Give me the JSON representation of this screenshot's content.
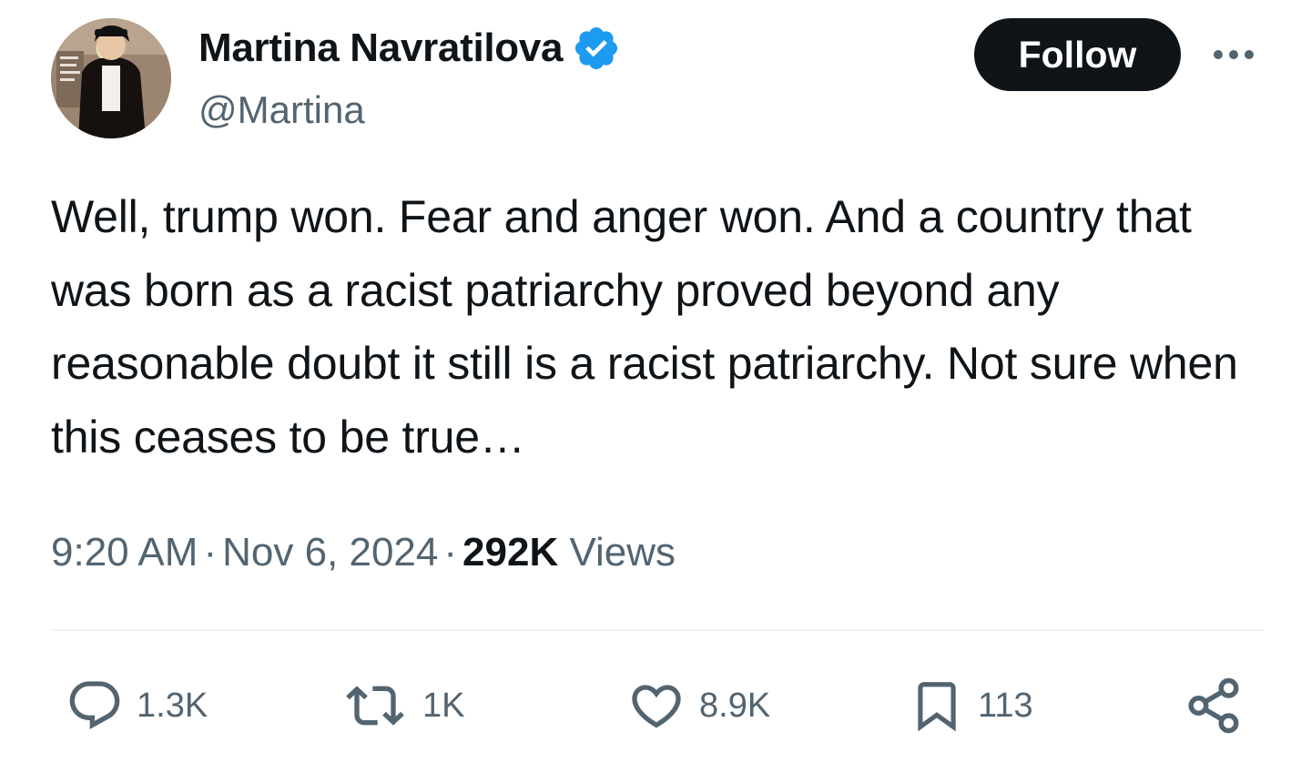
{
  "author": {
    "display_name": "Martina Navratilova",
    "handle": "@Martina",
    "verified": true
  },
  "header": {
    "follow_label": "Follow"
  },
  "tweet": {
    "text": "Well, trump won. Fear and anger won. And a country that was born as a racist patriarchy proved beyond any reasonable doubt it still is a racist patriarchy. Not sure when this ceases to be true…",
    "time": "9:20 AM",
    "date": "Nov 6, 2024",
    "separator": "·",
    "views_count": "292K",
    "views_label": "Views"
  },
  "actions": {
    "replies": "1.3K",
    "reposts": "1K",
    "likes": "8.9K",
    "bookmarks": "113"
  },
  "colors": {
    "text_primary": "#0f1419",
    "text_secondary": "#536471",
    "verified_blue": "#1d9bf0",
    "divider": "#eff3f4",
    "follow_bg": "#0f1419"
  },
  "icons": {
    "more": "more-dots-icon",
    "verified": "verified-badge-icon",
    "reply": "reply-icon",
    "repost": "repost-icon",
    "like": "heart-icon",
    "bookmark": "bookmark-icon",
    "share": "share-icon"
  }
}
